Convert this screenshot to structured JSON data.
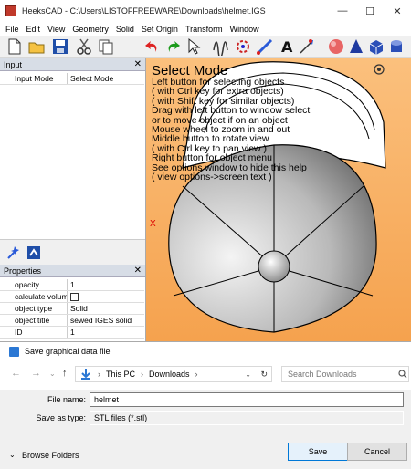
{
  "window": {
    "title": "HeeksCAD - C:\\Users\\LISTOFFREEWARE\\Downloads\\helmet.IGS",
    "minimize": "—",
    "maximize": "☐",
    "close": "✕"
  },
  "menu": [
    "File",
    "Edit",
    "View",
    "Geometry",
    "Solid",
    "Set Origin",
    "Transform",
    "Window"
  ],
  "toolbar": {
    "icons": [
      "new-file-icon",
      "open-folder-icon",
      "save-icon",
      "cut-icon",
      "copy-icon",
      "undo-icon",
      "redo-icon",
      "select-pointer-icon",
      "sketch-icon",
      "circle-icon",
      "line-icon",
      "text-icon",
      "dimension-icon",
      "sphere-icon",
      "cone-icon",
      "cube-icon",
      "cylinder-icon"
    ]
  },
  "input_pane": {
    "title": "Input",
    "close": "✕",
    "rows": [
      {
        "key": "Input Mode",
        "value": "Select Mode"
      }
    ]
  },
  "properties_pane": {
    "title": "Properties",
    "close": "✕",
    "rows": [
      {
        "key": "opacity",
        "value": "1"
      },
      {
        "key": "calculate volum",
        "value": ""
      },
      {
        "key": "object type",
        "value": "Solid"
      },
      {
        "key": "object title",
        "value": "sewed IGES solid"
      },
      {
        "key": "ID",
        "value": "1"
      }
    ]
  },
  "viewport": {
    "help_title": "Select Mode",
    "help_lines": [
      "Left button for selecting objects",
      "( with Ctrl key for extra objects)",
      "( with Shift key for similar objects)",
      "Drag with left button to window select",
      "or to move object if on an object",
      "Mouse wheel to zoom in and out",
      "Middle button to rotate view",
      "( with Ctrl key to pan view )",
      "Right button for object menu",
      "See options window to hide this help",
      "( view options->screen text )"
    ],
    "axis_label": "X",
    "model_color_body": "#d8d8d8",
    "background_top": "#fbc07d",
    "background_bottom": "#f5a24e"
  },
  "dialog": {
    "title": "Save graphical data file",
    "breadcrumb": [
      "This PC",
      "Downloads"
    ],
    "search_placeholder": "Search Downloads",
    "file_name_label": "File name:",
    "file_name_value": "helmet",
    "save_type_label": "Save as type:",
    "save_type_value": "STL files (*.stl)",
    "browse_folders": "Browse Folders",
    "save_button": "Save",
    "cancel_button": "Cancel"
  }
}
